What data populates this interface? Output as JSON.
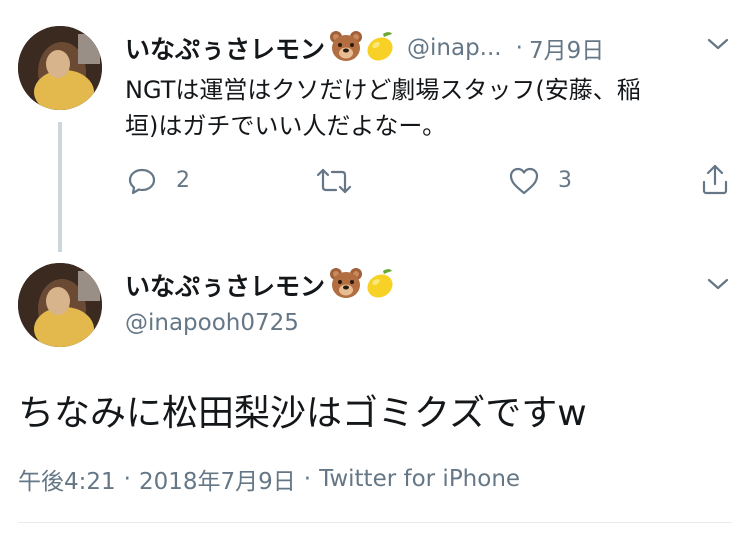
{
  "reply_tweet": {
    "display_name": "いなぷぅさレモン",
    "handle": "@inap...",
    "separator": "·",
    "date": "7月9日",
    "text_line1": "NGTは運営はクソだけど劇場スタッフ(安藤、稲",
    "text_line2": "垣)はガチでいい人だよなー。",
    "reply_count": "2",
    "like_count": "3",
    "icons": [
      "chevron-down-icon",
      "reply-icon",
      "retweet-icon",
      "like-icon",
      "share-icon"
    ]
  },
  "main_tweet": {
    "display_name": "いなぷぅさレモン",
    "handle": "@inapooh0725",
    "text": "ちなみに松田梨沙はゴミクズですw",
    "time": "午後4:21",
    "sep1": "·",
    "date": "2018年7月9日",
    "sep2": "·",
    "source": "Twitter for iPhone"
  },
  "colors": {
    "text": "#14171a",
    "secondary": "#657786",
    "thread_line": "#ccd6dd",
    "divider": "#e6ecf0"
  }
}
